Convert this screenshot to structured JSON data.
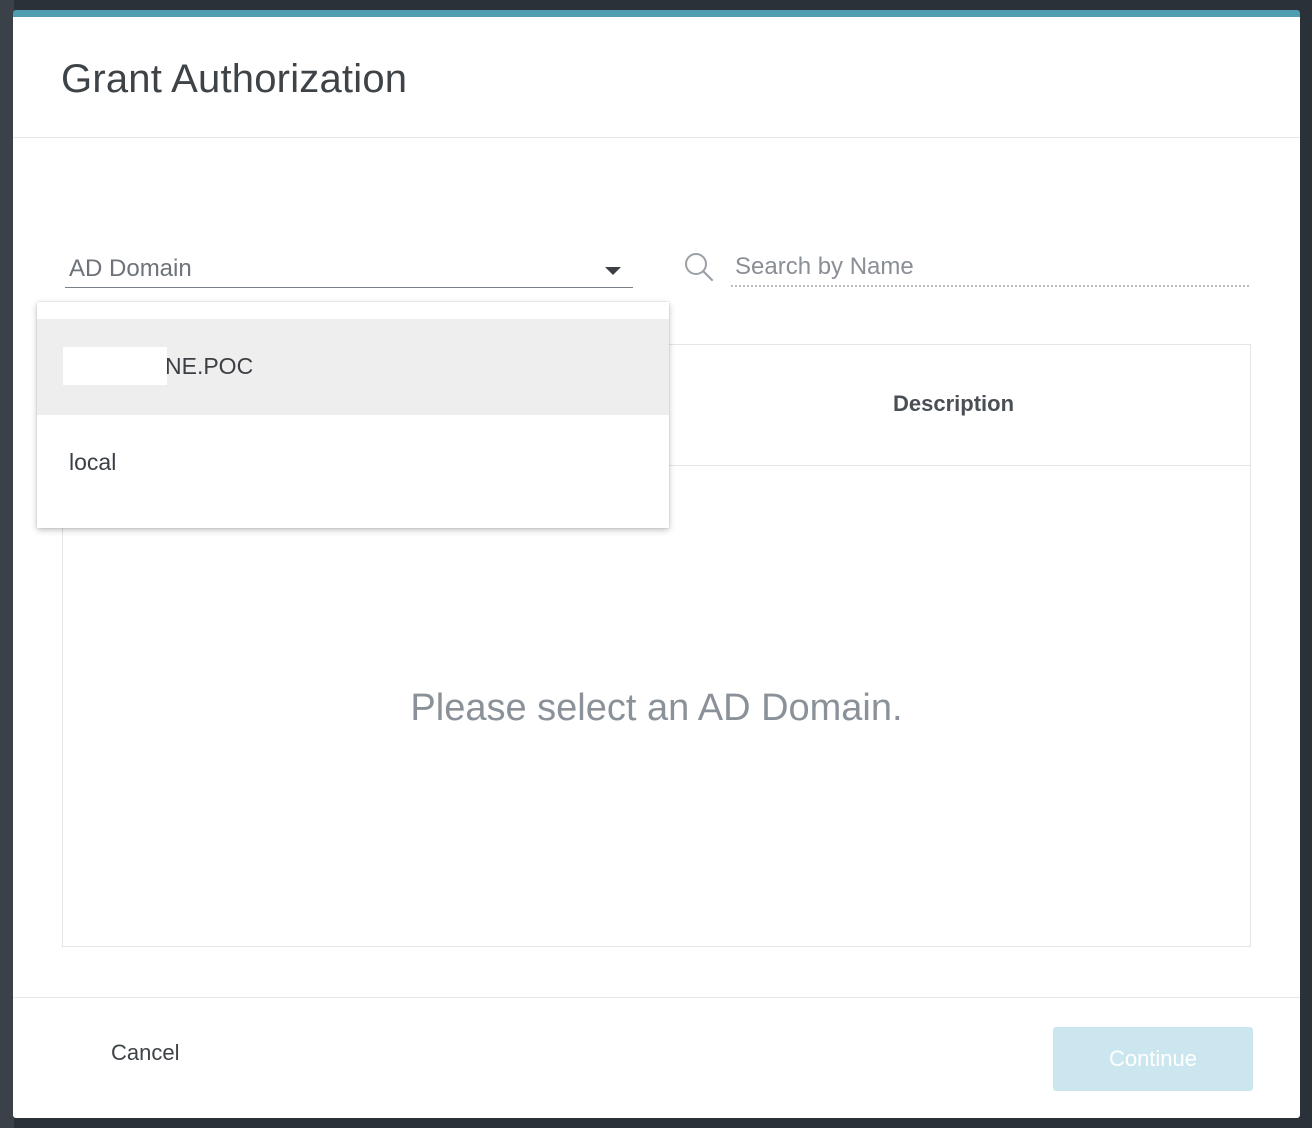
{
  "modal": {
    "title": "Grant Authorization"
  },
  "filters": {
    "domain_label": "AD Domain",
    "search_placeholder": "Search by Name"
  },
  "dropdown": {
    "options": [
      {
        "label": "NE.POC",
        "highlighted": true
      },
      {
        "label": "local",
        "highlighted": false
      }
    ]
  },
  "table": {
    "columns": [
      "Description"
    ],
    "empty_message": "Please select an AD Domain."
  },
  "footer": {
    "cancel_label": "Cancel",
    "continue_label": "Continue"
  },
  "colors": {
    "accent": "#4f9db0",
    "continue_disabled_bg": "#cbe6ee"
  }
}
